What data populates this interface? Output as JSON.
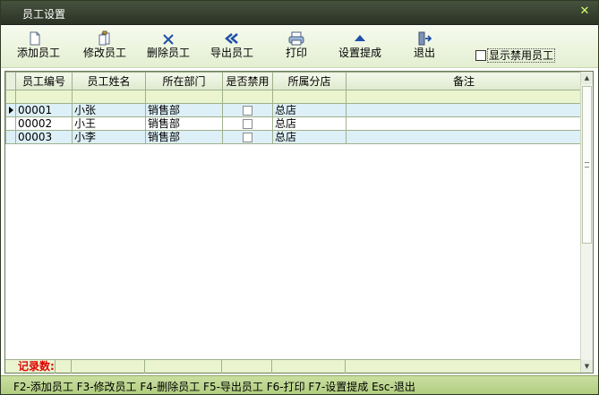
{
  "window": {
    "title": "员工设置",
    "close_icon": "close-icon"
  },
  "toolbar": {
    "buttons": [
      {
        "label": "添加员工",
        "icon": "document-icon"
      },
      {
        "label": "修改员工",
        "icon": "edit-document-icon"
      },
      {
        "label": "删除员工",
        "icon": "delete-x-icon"
      },
      {
        "label": "导出员工",
        "icon": "double-arrow-left-icon"
      },
      {
        "label": "打印",
        "icon": "printer-icon"
      },
      {
        "label": "设置提成",
        "icon": "triangle-up-icon"
      },
      {
        "label": "退出",
        "icon": "exit-door-icon"
      }
    ],
    "show_disabled_label": "显示禁用员工",
    "show_disabled_checked": false
  },
  "grid": {
    "columns": [
      "员工编号",
      "员工姓名",
      "所在部门",
      "是否禁用",
      "所属分店",
      "备注"
    ],
    "rows": [
      {
        "id": "00001",
        "name": "小张",
        "dept": "销售部",
        "disabled": false,
        "branch": "总店",
        "note": ""
      },
      {
        "id": "00002",
        "name": "小王",
        "dept": "销售部",
        "disabled": false,
        "branch": "总店",
        "note": ""
      },
      {
        "id": "00003",
        "name": "小李",
        "dept": "销售部",
        "disabled": false,
        "branch": "总店",
        "note": ""
      }
    ],
    "record_count_label": "记录数:"
  },
  "statusbar": {
    "text": "F2-添加员工 F3-修改员工 F4-删除员工 F5-导出员工 F6-打印 F7-设置提成 Esc-退出"
  },
  "colors": {
    "title_bar": "#2f3a28",
    "accent_green": "#b8d08c",
    "selected_row": "#ddf0f7",
    "filter_row": "#eaf5cf",
    "record_label": "#e00000"
  }
}
